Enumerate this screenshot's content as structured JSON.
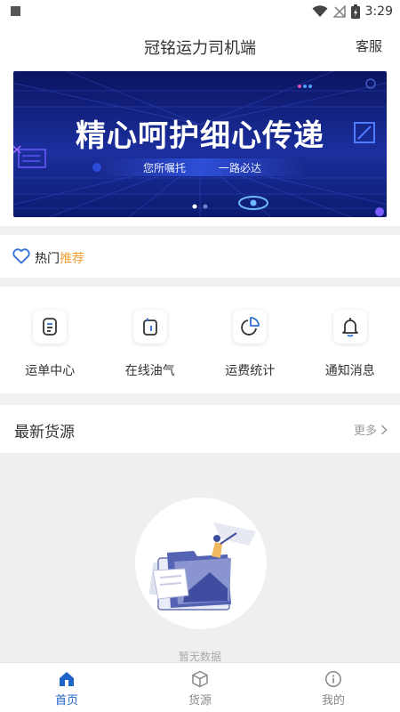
{
  "status_bar": {
    "time": "3:29"
  },
  "header": {
    "title": "冠铭运力司机端",
    "service": "客服"
  },
  "banner": {
    "headline": "精心呵护细心传递",
    "tagline_left": "您所嘱托",
    "tagline_right": "一路必达",
    "colors": {
      "bg_dark": "#0a1460",
      "bg_mid": "#1b2f9e",
      "accent": "#7a5cff"
    }
  },
  "hot": {
    "label_main": "热门",
    "label_accent": "推荐",
    "accent_color": "#f0a035"
  },
  "quick_actions": [
    {
      "label": "运单中心",
      "icon": "waybill-icon"
    },
    {
      "label": "在线油气",
      "icon": "fuel-icon"
    },
    {
      "label": "运费统计",
      "icon": "pie-chart-icon"
    },
    {
      "label": "通知消息",
      "icon": "bell-icon"
    }
  ],
  "latest": {
    "title": "最新货源",
    "more": "更多"
  },
  "empty": {
    "text": "暂无数据"
  },
  "tabbar": {
    "active_color": "#1e63c8",
    "tabs": [
      {
        "label": "首页",
        "icon": "home-icon",
        "active": true
      },
      {
        "label": "货源",
        "icon": "box-icon",
        "active": false
      },
      {
        "label": "我的",
        "icon": "user-info-icon",
        "active": false
      }
    ]
  }
}
